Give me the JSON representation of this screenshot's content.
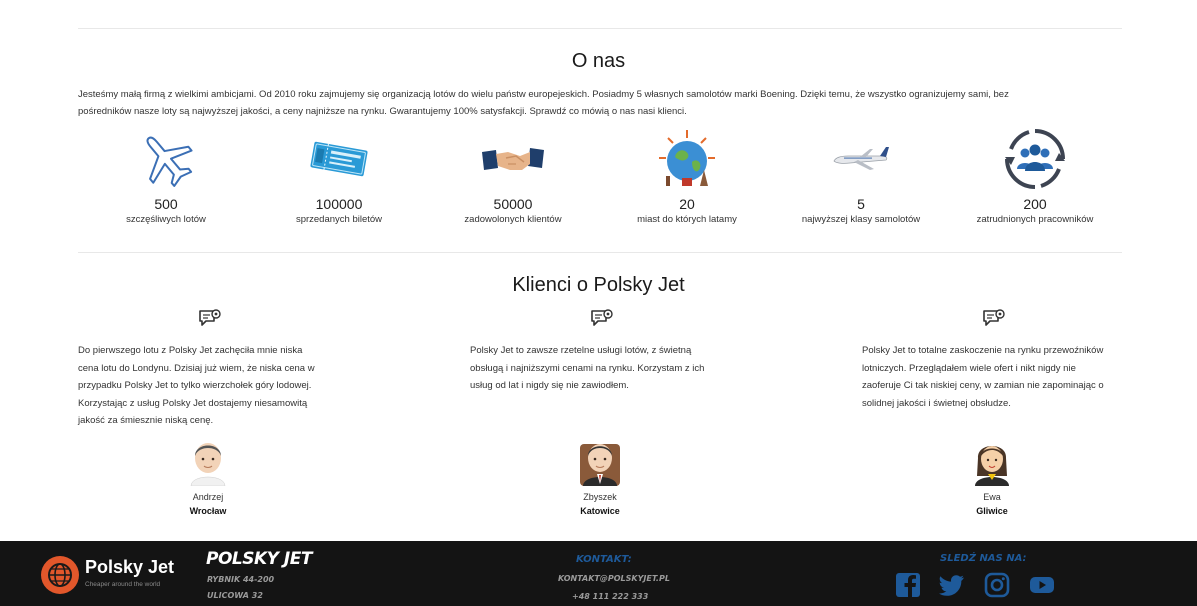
{
  "about": {
    "title": "O nas",
    "intro_line1": "Jesteśmy małą firmą z wielkimi ambicjami. Od 2010 roku zajmujemy się organizacją lotów do wielu państw europejeskich. Posiadmy 5 własnych samolotów marki Boening. Dzięki temu, że wszystko ogranizujemy sami, bez",
    "intro_line2": "pośredników nasze loty są najwyższej jakości, a ceny najniższe na rynku. Gwarantujemy 100% satysfakcji. Sprawdź co mówią o nas nasi klienci.",
    "stats": [
      {
        "icon": "airplane-outline-icon",
        "value": "500",
        "label": "szczęśliwych lotów"
      },
      {
        "icon": "ticket-icon",
        "value": "100000",
        "label": "sprzedanych biletów"
      },
      {
        "icon": "handshake-icon",
        "value": "50000",
        "label": "zadowolonych klientów"
      },
      {
        "icon": "globe-landmarks-icon",
        "value": "20",
        "label": "miast do których latamy"
      },
      {
        "icon": "jet-airplane-icon",
        "value": "5",
        "label": "najwyższej klasy samolotów"
      },
      {
        "icon": "team-cycle-icon",
        "value": "200",
        "label": "zatrudnionych pracowników"
      }
    ]
  },
  "testimonials": {
    "title": "Klienci o Polsky Jet",
    "items": [
      {
        "lines": [
          "Do pierwszego lotu z Polsky Jet zachęciła mnie niska",
          "cena lotu do Londynu. Dzisiaj już wiem, że niska cena w",
          "przypadku Polsky Jet to tylko wierzchołek góry lodowej.",
          "Korzystając z usług Polsky Jet dostajemy niesamowitą",
          "jakość za śmiesznie niską cenę."
        ],
        "name": "Andrzej",
        "city": "Wrocław"
      },
      {
        "lines": [
          "Polsky Jet to zawsze rzetelne usługi lotów, z świetną",
          "obsługą i najniższymi cenami na rynku. Korzystam z ich",
          "usług od lat i nigdy się nie zawiodłem."
        ],
        "name": "Zbyszek",
        "city": "Katowice"
      },
      {
        "lines": [
          "Polsky Jet to totalne zaskoczenie na rynku przewoźników",
          "lotniczych. Przeglądałem wiele ofert i nikt nigdy nie",
          "zaoferuje Ci tak niskiej ceny, w zamian nie zapominając o",
          "solidnej jakości i świetnej obsłudze."
        ],
        "name": "Ewa",
        "city": "Gliwice"
      }
    ]
  },
  "footer": {
    "logo_text": "Polsky Jet",
    "logo_tagline": "Cheaper around the world",
    "brand": "POLSKY JET",
    "address_line1": "RYBNIK 44-200",
    "address_line2": "ULICOWA 32",
    "contact_heading": "KONTAKT:",
    "contact_email": "KONTAKT@POLSKYJET.PL",
    "contact_phone": "+48 111 222 333",
    "follow_heading": "SLEDŹ NAS NA:",
    "colors": {
      "background": "#141414",
      "accent": "#1e5a9a",
      "logo_orange": "#e2572b",
      "social_blue": "#1e5a9a"
    }
  }
}
